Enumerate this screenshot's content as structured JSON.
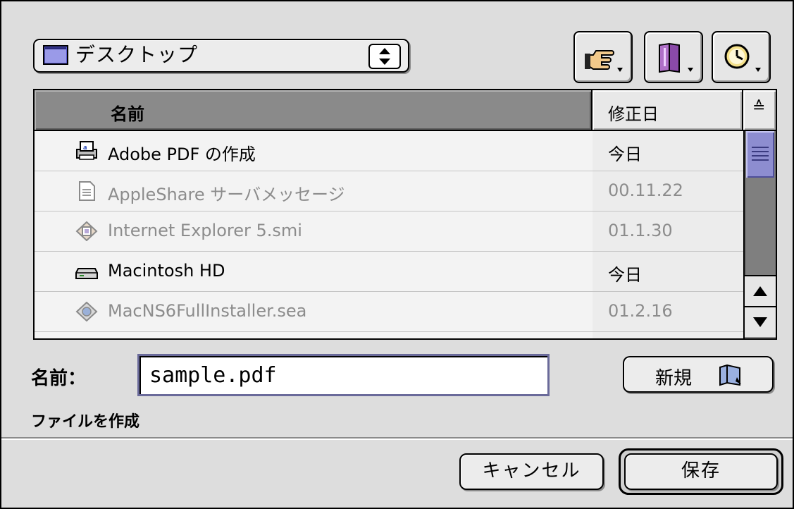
{
  "location": {
    "label": "デスクトップ"
  },
  "toolbar": {
    "shortcuts_icon": "pointing-hand-icon",
    "favorites_icon": "favorites-book-icon",
    "recent_icon": "clock-icon"
  },
  "list": {
    "col_name": "名前",
    "col_date": "修正日",
    "sort_glyph": "≙",
    "items": [
      {
        "name": "Adobe PDF の作成",
        "date": "今日",
        "icon": "pdf-printer-icon",
        "dim": false
      },
      {
        "name": "AppleShare サーバメッセージ",
        "date": "00.11.22",
        "icon": "text-document-icon",
        "dim": true
      },
      {
        "name": "Internet Explorer 5.smi",
        "date": "01.1.30",
        "icon": "disk-image-icon",
        "dim": true
      },
      {
        "name": "Macintosh HD",
        "date": "今日",
        "icon": "hard-drive-icon",
        "dim": false
      },
      {
        "name": "MacNS6FullInstaller.sea",
        "date": "01.2.16",
        "icon": "installer-archive-icon",
        "dim": true
      }
    ]
  },
  "name_field": {
    "label": "名前：",
    "value": "sample.pdf"
  },
  "new_folder_button": {
    "label": "新規"
  },
  "status_text": "ファイルを作成",
  "buttons": {
    "cancel": "キャンセル",
    "save": "保存"
  },
  "colors": {
    "scroll_thumb": "#8d8dd0",
    "header_selected": "#8a8a8a",
    "dialog_bg": "#dddddd"
  }
}
